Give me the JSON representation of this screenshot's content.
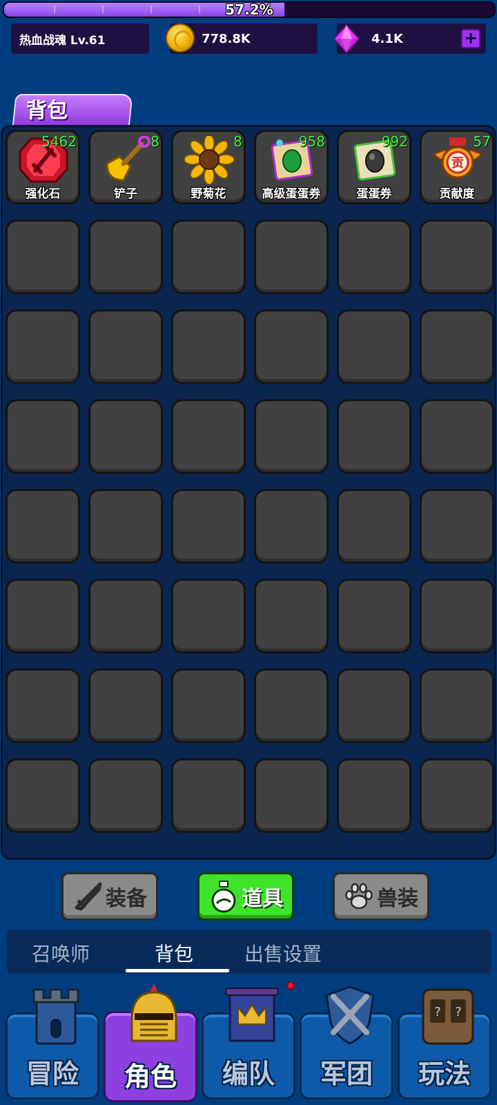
{
  "progress": {
    "value": 0.572,
    "text": "57.2%"
  },
  "resources": {
    "player_name": "热血战魂 Lv.61",
    "gold": "778.8K",
    "gems": "4.1K",
    "plus_label": "+"
  },
  "bag_title": "背包",
  "items": [
    {
      "name": "强化石",
      "count": "5462",
      "icon": "red-gem-sword-icon"
    },
    {
      "name": "铲子",
      "count": "8",
      "icon": "golden-shovel-icon"
    },
    {
      "name": "野菊花",
      "count": "8",
      "icon": "sunflower-icon"
    },
    {
      "name": "高级蛋蛋券",
      "count": "958",
      "icon": "green-egg-scroll-icon"
    },
    {
      "name": "蛋蛋券",
      "count": "992",
      "icon": "dark-egg-scroll-icon"
    },
    {
      "name": "贡献度",
      "count": "57",
      "icon": "contribution-medal-icon"
    }
  ],
  "categories": [
    {
      "label": "装备",
      "icon": "sword-icon",
      "active": false
    },
    {
      "label": "道具",
      "icon": "potion-icon",
      "active": true
    },
    {
      "label": "兽装",
      "icon": "paw-icon",
      "active": false
    }
  ],
  "subtabs": [
    {
      "label": "召唤师",
      "active": false
    },
    {
      "label": "背包",
      "active": true
    },
    {
      "label": "出售设置",
      "active": false
    }
  ],
  "nav": [
    {
      "label": "冒险",
      "icon": "castle-tower-icon",
      "active": false
    },
    {
      "label": "角色",
      "icon": "knight-helmet-icon",
      "active": true
    },
    {
      "label": "编队",
      "icon": "crown-banner-icon",
      "active": false
    },
    {
      "label": "军团",
      "icon": "crossed-swords-shield-icon",
      "active": false
    },
    {
      "label": "玩法",
      "icon": "lucky-slot-machine-icon",
      "active": false
    }
  ],
  "colors": {
    "background": "#003d7e",
    "count_green": "#3ef040",
    "active_tab_purple": "#8d3fe0",
    "active_category_green": "#3fe42a"
  }
}
